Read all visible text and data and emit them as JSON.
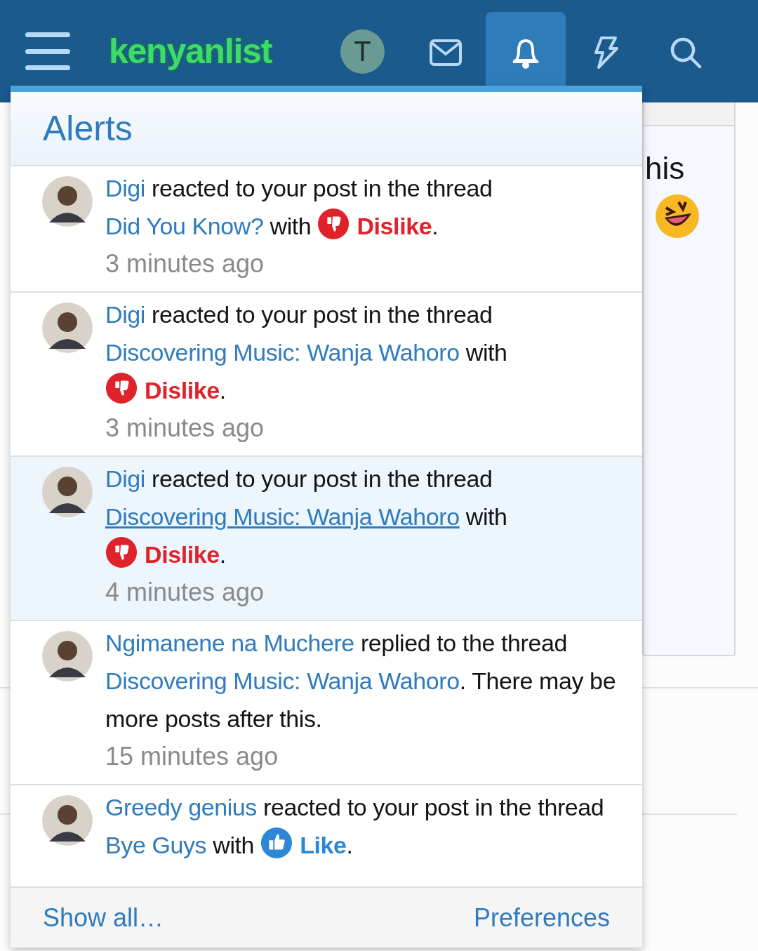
{
  "header": {
    "logo": "kenyanlist",
    "user_initial": "T",
    "nav": [
      {
        "kind": "inbox",
        "selected": false
      },
      {
        "kind": "alerts",
        "selected": true
      },
      {
        "kind": "whats_new",
        "selected": false
      },
      {
        "kind": "search",
        "selected": false
      }
    ]
  },
  "background": {
    "text": "his"
  },
  "alerts_popup": {
    "title": "Alerts",
    "items": [
      {
        "hovered": false,
        "time": "3 minutes ago",
        "message": [
          {
            "kind": "user",
            "text": "Digi"
          },
          {
            "kind": "text",
            "text": " reacted to your post in the thread "
          },
          {
            "kind": "link",
            "text": "Did You Know?"
          },
          {
            "kind": "text",
            "text": " with "
          },
          {
            "kind": "dislike",
            "text": "Dislike"
          },
          {
            "kind": "text",
            "text": "."
          }
        ]
      },
      {
        "hovered": false,
        "time": "3 minutes ago",
        "message": [
          {
            "kind": "user",
            "text": "Digi"
          },
          {
            "kind": "text",
            "text": " reacted to your post in the thread "
          },
          {
            "kind": "link",
            "text": "Discovering Music: Wanja Wahoro"
          },
          {
            "kind": "text",
            "text": " with "
          },
          {
            "kind": "dislike",
            "text": "Dislike"
          },
          {
            "kind": "text",
            "text": "."
          }
        ]
      },
      {
        "hovered": true,
        "time": "4 minutes ago",
        "message": [
          {
            "kind": "user",
            "text": "Digi"
          },
          {
            "kind": "text",
            "text": " reacted to your post in the thread "
          },
          {
            "kind": "link",
            "text": "Discovering Music: Wanja Wahoro"
          },
          {
            "kind": "text",
            "text": " with "
          },
          {
            "kind": "dislike",
            "text": "Dislike"
          },
          {
            "kind": "text",
            "text": "."
          }
        ]
      },
      {
        "hovered": false,
        "time": "15 minutes ago",
        "message": [
          {
            "kind": "user",
            "text": "Ngimanene na Muchere"
          },
          {
            "kind": "text",
            "text": " replied to the thread "
          },
          {
            "kind": "link",
            "text": "Discovering Music: Wanja Wahoro"
          },
          {
            "kind": "text",
            "text": ". There may be more posts after this."
          }
        ]
      },
      {
        "hovered": false,
        "message": [
          {
            "kind": "user",
            "text": "Greedy genius"
          },
          {
            "kind": "text",
            "text": " reacted to your post in the thread "
          },
          {
            "kind": "link",
            "text": "Bye Guys"
          },
          {
            "kind": "text",
            "text": " with "
          },
          {
            "kind": "like",
            "text": "Like"
          },
          {
            "kind": "text",
            "text": "."
          }
        ]
      }
    ],
    "footer": {
      "show_all": "Show all…",
      "preferences": "Preferences"
    }
  }
}
